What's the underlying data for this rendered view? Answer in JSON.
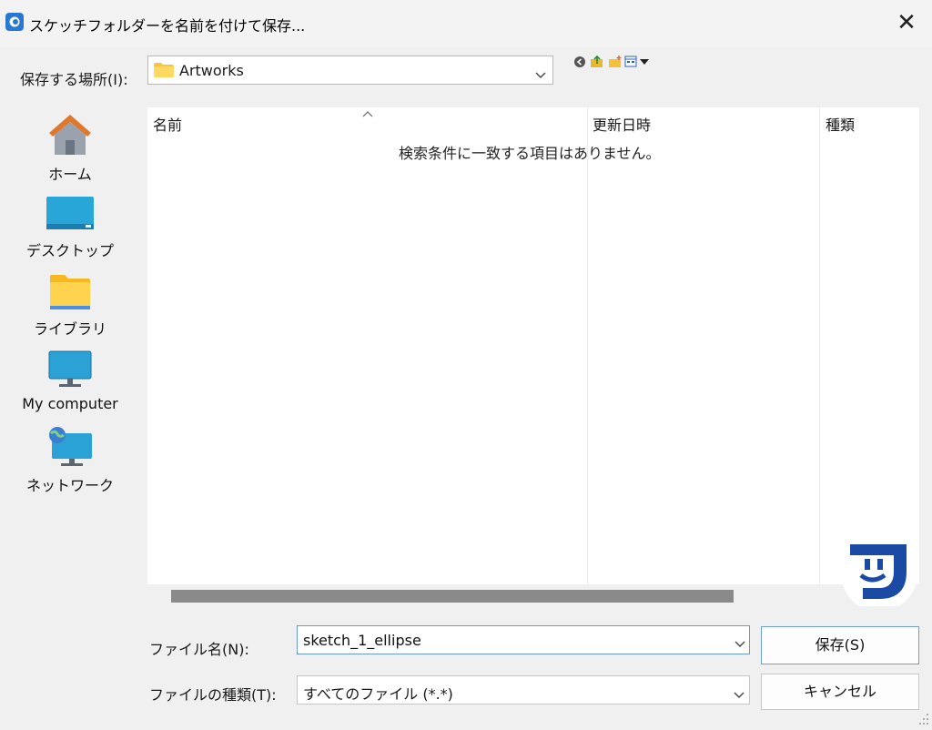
{
  "window": {
    "title": "スケッチフォルダーを名前を付けて保存...",
    "close_label": "✕"
  },
  "lookin": {
    "label": "保存する場所(I):",
    "value": "Artworks"
  },
  "toolbar_icons": [
    "back-icon",
    "up-folder-icon",
    "new-folder-icon",
    "view-menu-icon"
  ],
  "places": [
    {
      "label": "ホーム",
      "icon": "home-icon"
    },
    {
      "label": "デスクトップ",
      "icon": "desktop-icon"
    },
    {
      "label": "ライブラリ",
      "icon": "library-folder-icon"
    },
    {
      "label": "My computer",
      "icon": "computer-icon"
    },
    {
      "label": "ネットワーク",
      "icon": "network-icon"
    }
  ],
  "filelist": {
    "columns": [
      "名前",
      "更新日時",
      "種類"
    ],
    "empty_message": "検索条件に一致する項目はありません。"
  },
  "form": {
    "filename_label": "ファイル名(N):",
    "filename_value": "sketch_1_ellipse",
    "filetype_label": "ファイルの種類(T):",
    "filetype_value": "すべてのファイル (*.*)",
    "save_label": "保存(S)",
    "cancel_label": "キャンセル"
  },
  "colors": {
    "accent": "#1f5fbf",
    "logo_blue": "#1b4aa5"
  }
}
